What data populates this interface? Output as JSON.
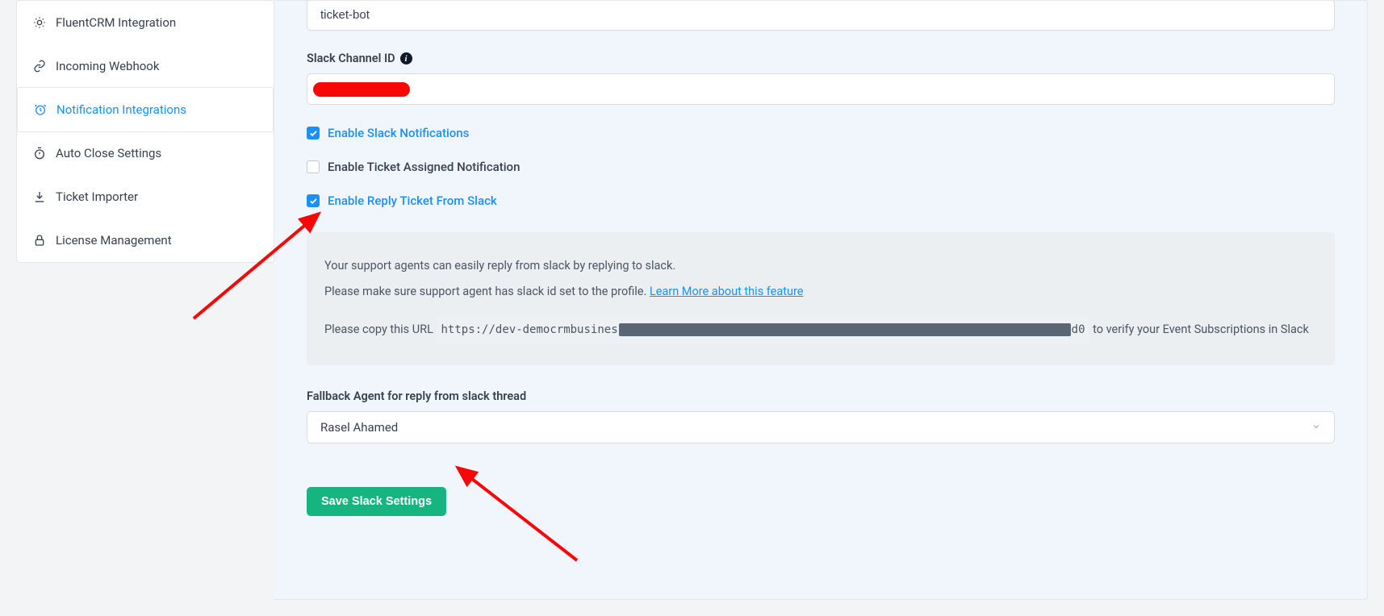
{
  "sidebar": {
    "items": [
      {
        "label": "FluentCRM Integration",
        "name": "sidebar-item-fluentcrm",
        "icon": "sun"
      },
      {
        "label": "Incoming Webhook",
        "name": "sidebar-item-incoming-webhook",
        "icon": "link"
      },
      {
        "label": "Notification Integrations",
        "name": "sidebar-item-notification-integrations",
        "icon": "clock",
        "active": true
      },
      {
        "label": "Auto Close Settings",
        "name": "sidebar-item-auto-close",
        "icon": "stopwatch"
      },
      {
        "label": "Ticket Importer",
        "name": "sidebar-item-ticket-importer",
        "icon": "download"
      },
      {
        "label": "License Management",
        "name": "sidebar-item-license",
        "icon": "lock"
      }
    ]
  },
  "form": {
    "channel_name_value": "ticket-bot",
    "channel_id_label": "Slack Channel ID",
    "enable_notifications_label": "Enable Slack Notifications",
    "enable_assigned_label": "Enable Ticket Assigned Notification",
    "enable_reply_label": "Enable Reply Ticket From Slack",
    "info_line1": "Your support agents can easily reply from slack by replying to slack.",
    "info_line2_pre": "Please make sure support agent has slack id set to the profile. ",
    "info_link": "Learn More about this feature",
    "info_copy_pre": "Please copy this URL ",
    "info_url_prefix": "https://dev-democrmbusines",
    "info_url_suffix": "d0",
    "info_copy_post": " to verify your Event Subscriptions in Slack",
    "fallback_label": "Fallback Agent for reply from slack thread",
    "fallback_value": "Rasel Ahamed",
    "save_button": "Save Slack Settings"
  }
}
